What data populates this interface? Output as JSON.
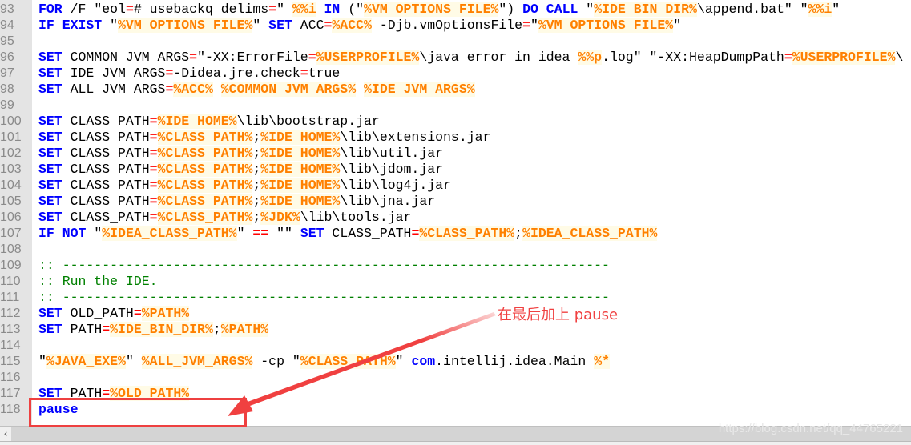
{
  "editor": {
    "lines": [
      {
        "n": "93",
        "tokens": [
          [
            "k",
            "FOR"
          ],
          [
            "t",
            " /F \"eol"
          ],
          [
            "o",
            "="
          ],
          [
            "t",
            "# usebackq delims"
          ],
          [
            "o",
            "="
          ],
          [
            "t",
            "\" "
          ],
          [
            "v",
            "%%i"
          ],
          [
            "t",
            " "
          ],
          [
            "k",
            "IN"
          ],
          [
            "t",
            " (\""
          ],
          [
            "v",
            "%VM_OPTIONS_FILE%"
          ],
          [
            "t",
            "\") "
          ],
          [
            "k",
            "DO CALL"
          ],
          [
            "t",
            " \""
          ],
          [
            "v",
            "%IDE_BIN_DIR%"
          ],
          [
            "t",
            "\\append.bat\" \""
          ],
          [
            "v",
            "%%i"
          ],
          [
            "t",
            "\""
          ]
        ]
      },
      {
        "n": "94",
        "tokens": [
          [
            "k",
            "IF EXIST"
          ],
          [
            "t",
            " \""
          ],
          [
            "v",
            "%VM_OPTIONS_FILE%"
          ],
          [
            "t",
            "\" "
          ],
          [
            "k",
            "SET"
          ],
          [
            "t",
            " ACC"
          ],
          [
            "o",
            "="
          ],
          [
            "v",
            "%ACC%"
          ],
          [
            "t",
            " -Djb.vmOptionsFile"
          ],
          [
            "o",
            "="
          ],
          [
            "t",
            "\""
          ],
          [
            "v",
            "%VM_OPTIONS_FILE%"
          ],
          [
            "t",
            "\""
          ]
        ]
      },
      {
        "n": "95",
        "tokens": []
      },
      {
        "n": "96",
        "tokens": [
          [
            "k",
            "SET"
          ],
          [
            "t",
            " COMMON_JVM_ARGS"
          ],
          [
            "o",
            "="
          ],
          [
            "t",
            "\"-XX:ErrorFile"
          ],
          [
            "o",
            "="
          ],
          [
            "v",
            "%USERPROFILE%"
          ],
          [
            "t",
            "\\java_error_in_idea_"
          ],
          [
            "v",
            "%%p"
          ],
          [
            "t",
            ".log\" \"-XX:HeapDumpPath"
          ],
          [
            "o",
            "="
          ],
          [
            "v",
            "%USERPROFILE%"
          ],
          [
            "t",
            "\\"
          ]
        ]
      },
      {
        "n": "97",
        "tokens": [
          [
            "k",
            "SET"
          ],
          [
            "t",
            " IDE_JVM_ARGS"
          ],
          [
            "o",
            "="
          ],
          [
            "t",
            "-Didea.jre.check"
          ],
          [
            "o",
            "="
          ],
          [
            "t",
            "true"
          ]
        ]
      },
      {
        "n": "98",
        "tokens": [
          [
            "k",
            "SET"
          ],
          [
            "t",
            " ALL_JVM_ARGS"
          ],
          [
            "o",
            "="
          ],
          [
            "v",
            "%ACC%"
          ],
          [
            "t",
            " "
          ],
          [
            "v",
            "%COMMON_JVM_ARGS%"
          ],
          [
            "t",
            " "
          ],
          [
            "v",
            "%IDE_JVM_ARGS%"
          ]
        ]
      },
      {
        "n": "99",
        "tokens": []
      },
      {
        "n": "100",
        "tokens": [
          [
            "k",
            "SET"
          ],
          [
            "t",
            " CLASS_PATH"
          ],
          [
            "o",
            "="
          ],
          [
            "v",
            "%IDE_HOME%"
          ],
          [
            "t",
            "\\lib\\bootstrap.jar"
          ]
        ]
      },
      {
        "n": "101",
        "tokens": [
          [
            "k",
            "SET"
          ],
          [
            "t",
            " CLASS_PATH"
          ],
          [
            "o",
            "="
          ],
          [
            "v",
            "%CLASS_PATH%"
          ],
          [
            "t",
            ";"
          ],
          [
            "v",
            "%IDE_HOME%"
          ],
          [
            "t",
            "\\lib\\extensions.jar"
          ]
        ]
      },
      {
        "n": "102",
        "tokens": [
          [
            "k",
            "SET"
          ],
          [
            "t",
            " CLASS_PATH"
          ],
          [
            "o",
            "="
          ],
          [
            "v",
            "%CLASS_PATH%"
          ],
          [
            "t",
            ";"
          ],
          [
            "v",
            "%IDE_HOME%"
          ],
          [
            "t",
            "\\lib\\util.jar"
          ]
        ]
      },
      {
        "n": "103",
        "tokens": [
          [
            "k",
            "SET"
          ],
          [
            "t",
            " CLASS_PATH"
          ],
          [
            "o",
            "="
          ],
          [
            "v",
            "%CLASS_PATH%"
          ],
          [
            "t",
            ";"
          ],
          [
            "v",
            "%IDE_HOME%"
          ],
          [
            "t",
            "\\lib\\jdom.jar"
          ]
        ]
      },
      {
        "n": "104",
        "tokens": [
          [
            "k",
            "SET"
          ],
          [
            "t",
            " CLASS_PATH"
          ],
          [
            "o",
            "="
          ],
          [
            "v",
            "%CLASS_PATH%"
          ],
          [
            "t",
            ";"
          ],
          [
            "v",
            "%IDE_HOME%"
          ],
          [
            "t",
            "\\lib\\log4j.jar"
          ]
        ]
      },
      {
        "n": "105",
        "tokens": [
          [
            "k",
            "SET"
          ],
          [
            "t",
            " CLASS_PATH"
          ],
          [
            "o",
            "="
          ],
          [
            "v",
            "%CLASS_PATH%"
          ],
          [
            "t",
            ";"
          ],
          [
            "v",
            "%IDE_HOME%"
          ],
          [
            "t",
            "\\lib\\jna.jar"
          ]
        ]
      },
      {
        "n": "106",
        "tokens": [
          [
            "k",
            "SET"
          ],
          [
            "t",
            " CLASS_PATH"
          ],
          [
            "o",
            "="
          ],
          [
            "v",
            "%CLASS_PATH%"
          ],
          [
            "t",
            ";"
          ],
          [
            "v",
            "%JDK%"
          ],
          [
            "t",
            "\\lib\\tools.jar"
          ]
        ]
      },
      {
        "n": "107",
        "tokens": [
          [
            "k",
            "IF NOT"
          ],
          [
            "t",
            " \""
          ],
          [
            "v",
            "%IDEA_CLASS_PATH%"
          ],
          [
            "t",
            "\" "
          ],
          [
            "o",
            "=="
          ],
          [
            "t",
            " \"\" "
          ],
          [
            "k",
            "SET"
          ],
          [
            "t",
            " CLASS_PATH"
          ],
          [
            "o",
            "="
          ],
          [
            "v",
            "%CLASS_PATH%"
          ],
          [
            "t",
            ";"
          ],
          [
            "v",
            "%IDEA_CLASS_PATH%"
          ]
        ]
      },
      {
        "n": "108",
        "tokens": []
      },
      {
        "n": "109",
        "tokens": [
          [
            "c",
            ":: ---------------------------------------------------------------------"
          ]
        ]
      },
      {
        "n": "110",
        "tokens": [
          [
            "c",
            ":: Run the IDE."
          ]
        ]
      },
      {
        "n": "111",
        "tokens": [
          [
            "c",
            ":: ---------------------------------------------------------------------"
          ]
        ]
      },
      {
        "n": "112",
        "tokens": [
          [
            "k",
            "SET"
          ],
          [
            "t",
            " OLD_PATH"
          ],
          [
            "o",
            "="
          ],
          [
            "v",
            "%PATH%"
          ]
        ]
      },
      {
        "n": "113",
        "tokens": [
          [
            "k",
            "SET"
          ],
          [
            "t",
            " PATH"
          ],
          [
            "o",
            "="
          ],
          [
            "v",
            "%IDE_BIN_DIR%"
          ],
          [
            "t",
            ";"
          ],
          [
            "v",
            "%PATH%"
          ]
        ]
      },
      {
        "n": "114",
        "tokens": []
      },
      {
        "n": "115",
        "tokens": [
          [
            "t",
            "\""
          ],
          [
            "v",
            "%JAVA_EXE%"
          ],
          [
            "t",
            "\" "
          ],
          [
            "v",
            "%ALL_JVM_ARGS%"
          ],
          [
            "t",
            " -cp \""
          ],
          [
            "v",
            "%CLASS_PATH%"
          ],
          [
            "t",
            "\" "
          ],
          [
            "k",
            "com"
          ],
          [
            "t",
            ".intellij.idea.Main "
          ],
          [
            "v",
            "%*"
          ]
        ]
      },
      {
        "n": "116",
        "tokens": []
      },
      {
        "n": "117",
        "tokens": [
          [
            "k",
            "SET"
          ],
          [
            "t",
            " PATH"
          ],
          [
            "o",
            "="
          ],
          [
            "v",
            "%OLD_PATH%"
          ]
        ]
      },
      {
        "n": "118",
        "tokens": [
          [
            "k",
            "pause"
          ]
        ]
      }
    ]
  },
  "annotation": {
    "text": "在最后加上 pause",
    "color": "#f04040"
  },
  "scrollbar": {
    "left_arrow": "‹"
  },
  "watermark": "https://blog.csdn.net/qq_44765221",
  "colors": {
    "keyword": "#0000ff",
    "variable": "#ff8000",
    "operator": "#ff0000",
    "comment": "#008000"
  }
}
